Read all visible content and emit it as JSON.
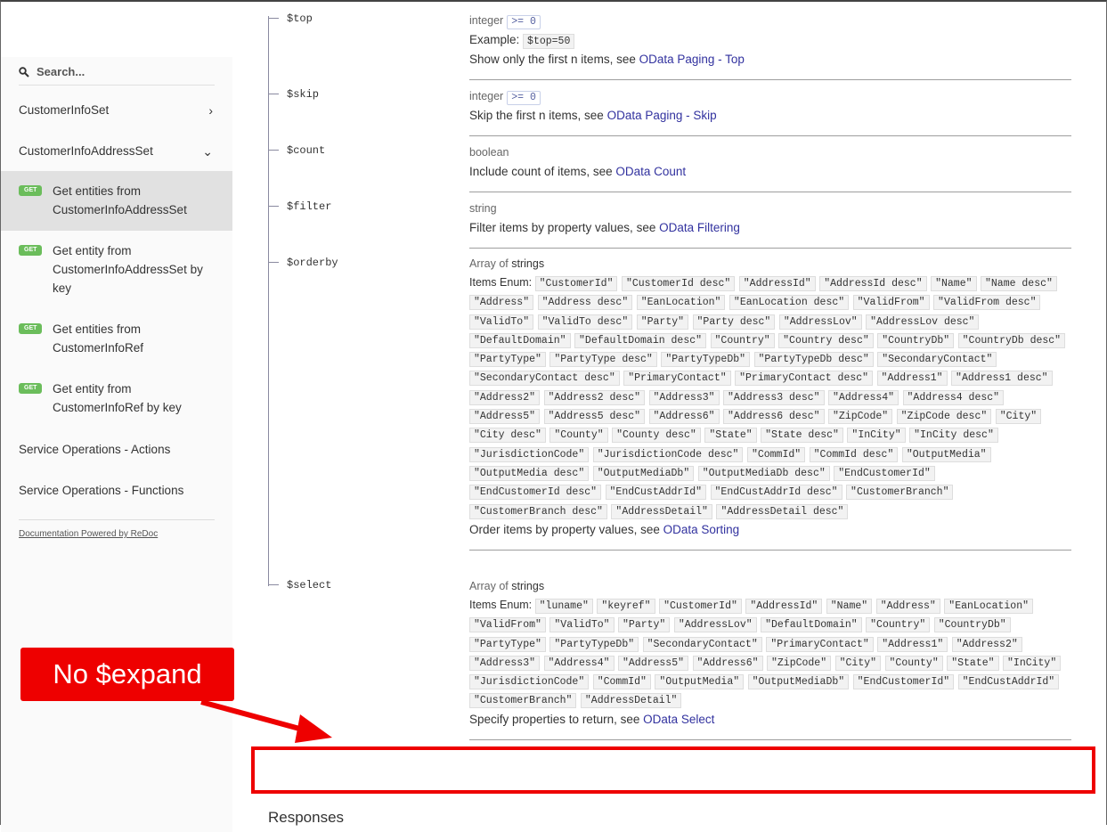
{
  "sidebar": {
    "search_placeholder": "Search...",
    "groups": [
      {
        "label": "CustomerInfoSet"
      },
      {
        "label": "CustomerInfoAddressSet"
      }
    ],
    "ops": [
      {
        "method": "GET",
        "label": "Get entities from CustomerInfoAddressSet"
      },
      {
        "method": "GET",
        "label": "Get entity from CustomerInfoAddressSet by key"
      },
      {
        "method": "GET",
        "label": "Get entities from CustomerInfoRef"
      },
      {
        "method": "GET",
        "label": "Get entity from CustomerInfoRef by key"
      }
    ],
    "sections": [
      "Service Operations - Actions",
      "Service Operations - Functions"
    ],
    "footer": "Documentation Powered by ReDoc"
  },
  "params": {
    "top": {
      "name": "$top",
      "type": "integer",
      "constraint": ">= 0",
      "example_label": "Example:",
      "example": "$top=50",
      "desc": "Show only the first n items, see ",
      "link": "OData Paging - Top"
    },
    "skip": {
      "name": "$skip",
      "type": "integer",
      "constraint": ">= 0",
      "desc": "Skip the first n items, see ",
      "link": "OData Paging - Skip"
    },
    "count": {
      "name": "$count",
      "type": "boolean",
      "desc": "Include count of items, see ",
      "link": "OData Count"
    },
    "filter": {
      "name": "$filter",
      "type": "string",
      "desc": "Filter items by property values, see ",
      "link": "OData Filtering"
    },
    "orderby": {
      "name": "$orderby",
      "type_prefix": "Array of ",
      "type": "strings",
      "enum_label": "Items Enum:",
      "enum": [
        "\"CustomerId\"",
        "\"CustomerId desc\"",
        "\"AddressId\"",
        "\"AddressId desc\"",
        "\"Name\"",
        "\"Name desc\"",
        "\"Address\"",
        "\"Address desc\"",
        "\"EanLocation\"",
        "\"EanLocation desc\"",
        "\"ValidFrom\"",
        "\"ValidFrom desc\"",
        "\"ValidTo\"",
        "\"ValidTo desc\"",
        "\"Party\"",
        "\"Party desc\"",
        "\"AddressLov\"",
        "\"AddressLov desc\"",
        "\"DefaultDomain\"",
        "\"DefaultDomain desc\"",
        "\"Country\"",
        "\"Country desc\"",
        "\"CountryDb\"",
        "\"CountryDb desc\"",
        "\"PartyType\"",
        "\"PartyType desc\"",
        "\"PartyTypeDb\"",
        "\"PartyTypeDb desc\"",
        "\"SecondaryContact\"",
        "\"SecondaryContact desc\"",
        "\"PrimaryContact\"",
        "\"PrimaryContact desc\"",
        "\"Address1\"",
        "\"Address1 desc\"",
        "\"Address2\"",
        "\"Address2 desc\"",
        "\"Address3\"",
        "\"Address3 desc\"",
        "\"Address4\"",
        "\"Address4 desc\"",
        "\"Address5\"",
        "\"Address5 desc\"",
        "\"Address6\"",
        "\"Address6 desc\"",
        "\"ZipCode\"",
        "\"ZipCode desc\"",
        "\"City\"",
        "\"City desc\"",
        "\"County\"",
        "\"County desc\"",
        "\"State\"",
        "\"State desc\"",
        "\"InCity\"",
        "\"InCity desc\"",
        "\"JurisdictionCode\"",
        "\"JurisdictionCode desc\"",
        "\"CommId\"",
        "\"CommId desc\"",
        "\"OutputMedia\"",
        "\"OutputMedia desc\"",
        "\"OutputMediaDb\"",
        "\"OutputMediaDb desc\"",
        "\"EndCustomerId\"",
        "\"EndCustomerId desc\"",
        "\"EndCustAddrId\"",
        "\"EndCustAddrId desc\"",
        "\"CustomerBranch\"",
        "\"CustomerBranch desc\"",
        "\"AddressDetail\"",
        "\"AddressDetail desc\""
      ],
      "desc": "Order items by property values, see ",
      "link": "OData Sorting"
    },
    "select": {
      "name": "$select",
      "type_prefix": "Array of ",
      "type": "strings",
      "enum_label": "Items Enum:",
      "enum": [
        "\"luname\"",
        "\"keyref\"",
        "\"CustomerId\"",
        "\"AddressId\"",
        "\"Name\"",
        "\"Address\"",
        "\"EanLocation\"",
        "\"ValidFrom\"",
        "\"ValidTo\"",
        "\"Party\"",
        "\"AddressLov\"",
        "\"DefaultDomain\"",
        "\"Country\"",
        "\"CountryDb\"",
        "\"PartyType\"",
        "\"PartyTypeDb\"",
        "\"SecondaryContact\"",
        "\"PrimaryContact\"",
        "\"Address1\"",
        "\"Address2\"",
        "\"Address3\"",
        "\"Address4\"",
        "\"Address5\"",
        "\"Address6\"",
        "\"ZipCode\"",
        "\"City\"",
        "\"County\"",
        "\"State\"",
        "\"InCity\"",
        "\"JurisdictionCode\"",
        "\"CommId\"",
        "\"OutputMedia\"",
        "\"OutputMediaDb\"",
        "\"EndCustomerId\"",
        "\"EndCustAddrId\"",
        "\"CustomerBranch\"",
        "\"AddressDetail\""
      ],
      "desc": "Specify properties to return, see ",
      "link": "OData Select"
    }
  },
  "annotation": {
    "callout": "No $expand",
    "color": "#e00000"
  },
  "responses_heading": "Responses"
}
